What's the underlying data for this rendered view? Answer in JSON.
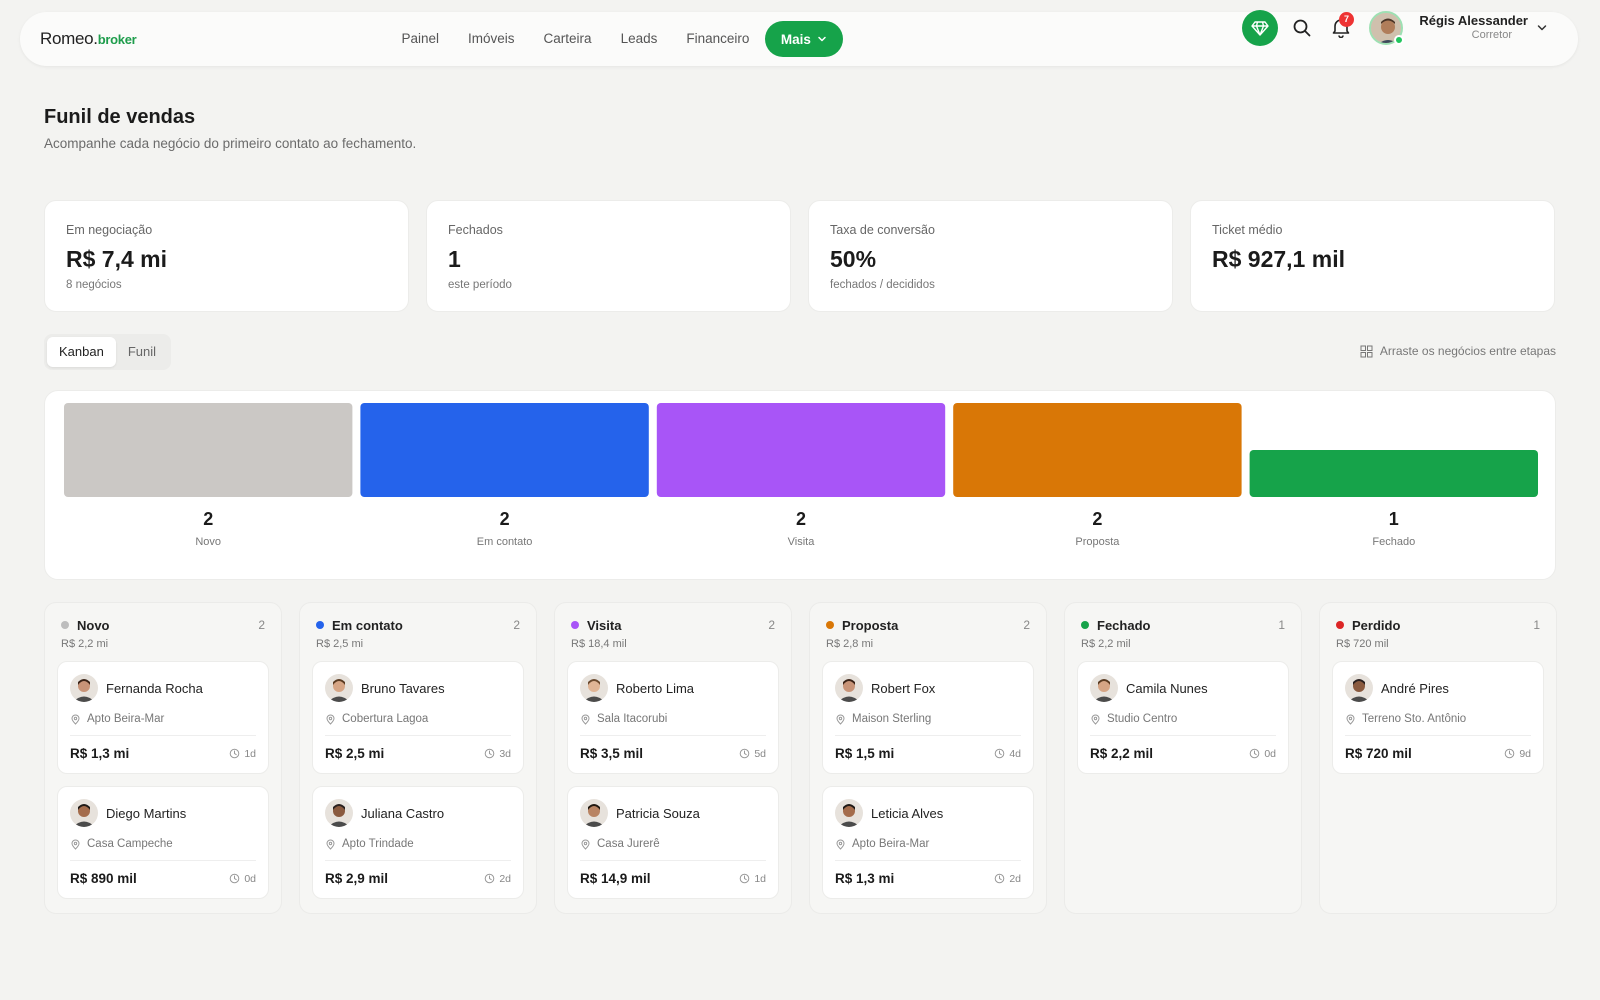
{
  "brand": {
    "name": "Romeo.",
    "suffix": "broker"
  },
  "nav": {
    "items": [
      "Painel",
      "Imóveis",
      "Carteira",
      "Leads",
      "Financeiro"
    ],
    "more_label": "Mais"
  },
  "header_tools": {
    "notification_count": "7",
    "user_name": "Régis Alessander",
    "user_role": "Corretor",
    "accent": "#16a34a"
  },
  "page": {
    "title": "Funil de vendas",
    "subtitle": "Acompanhe cada negócio do primeiro contato ao fechamento."
  },
  "stats": [
    {
      "label": "Em negociação",
      "value": "R$ 7,4 mi",
      "sub": "8 negócios"
    },
    {
      "label": "Fechados",
      "value": "1",
      "sub": "este período"
    },
    {
      "label": "Taxa de conversão",
      "value": "50%",
      "sub": "fechados / decididos"
    },
    {
      "label": "Ticket médio",
      "value": "R$ 927,1 mil",
      "sub": ""
    }
  ],
  "view_tabs": {
    "active": "Kanban",
    "items": [
      "Kanban",
      "Funil"
    ]
  },
  "drag_hint": "Arraste os negócios entre etapas",
  "chart_data": {
    "type": "bar",
    "categories": [
      "Novo",
      "Em contato",
      "Visita",
      "Proposta",
      "Fechado"
    ],
    "values": [
      2,
      2,
      2,
      2,
      1
    ],
    "colors": [
      "#cbc8c5",
      "#2563eb",
      "#a855f7",
      "#d97706",
      "#16a34a"
    ],
    "ylim": [
      0,
      2
    ]
  },
  "columns": [
    {
      "title": "Novo",
      "count": "2",
      "total": "R$ 2,2 mi",
      "color": "#bdbdbd",
      "cards": [
        {
          "name": "Fernanda Rocha",
          "location": "Apto Beira-Mar",
          "value": "R$ 1,3 mi",
          "age": "1d"
        },
        {
          "name": "Diego Martins",
          "location": "Casa Campeche",
          "value": "R$ 890 mil",
          "age": "0d"
        }
      ]
    },
    {
      "title": "Em contato",
      "count": "2",
      "total": "R$ 2,5 mi",
      "color": "#2563eb",
      "cards": [
        {
          "name": "Bruno Tavares",
          "location": "Cobertura Lagoa",
          "value": "R$ 2,5 mi",
          "age": "3d"
        },
        {
          "name": "Juliana Castro",
          "location": "Apto Trindade",
          "value": "R$ 2,9 mil",
          "age": "2d"
        }
      ]
    },
    {
      "title": "Visita",
      "count": "2",
      "total": "R$ 18,4 mil",
      "color": "#a855f7",
      "cards": [
        {
          "name": "Roberto Lima",
          "location": "Sala Itacorubi",
          "value": "R$ 3,5 mil",
          "age": "5d"
        },
        {
          "name": "Patricia Souza",
          "location": "Casa Jurerê",
          "value": "R$ 14,9 mil",
          "age": "1d"
        }
      ]
    },
    {
      "title": "Proposta",
      "count": "2",
      "total": "R$ 2,8 mi",
      "color": "#d97706",
      "cards": [
        {
          "name": "Robert Fox",
          "location": "Maison Sterling",
          "value": "R$ 1,5 mi",
          "age": "4d"
        },
        {
          "name": "Leticia Alves",
          "location": "Apto Beira-Mar",
          "value": "R$ 1,3 mi",
          "age": "2d"
        }
      ]
    },
    {
      "title": "Fechado",
      "count": "1",
      "total": "R$ 2,2 mil",
      "color": "#16a34a",
      "cards": [
        {
          "name": "Camila Nunes",
          "location": "Studio Centro",
          "value": "R$ 2,2 mil",
          "age": "0d"
        }
      ]
    },
    {
      "title": "Perdido",
      "count": "1",
      "total": "R$ 720 mil",
      "color": "#dc2626",
      "cards": [
        {
          "name": "André Pires",
          "location": "Terreno Sto. Antônio",
          "value": "R$ 720 mil",
          "age": "9d"
        }
      ]
    }
  ]
}
